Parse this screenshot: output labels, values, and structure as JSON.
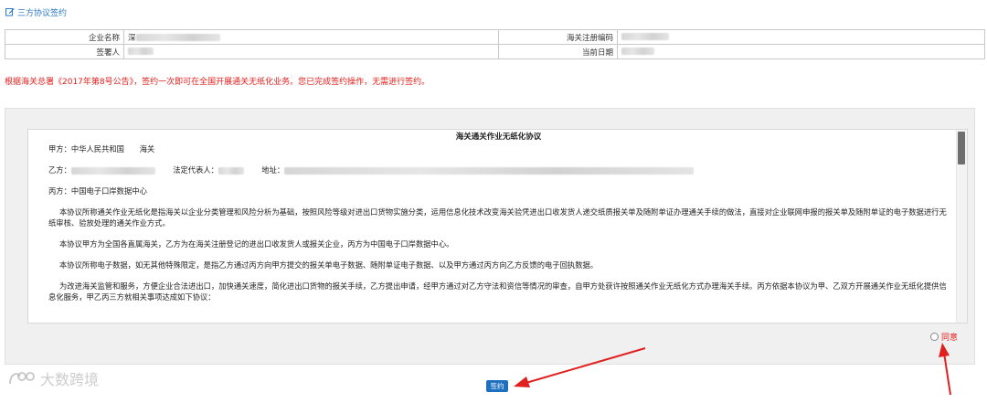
{
  "section": {
    "title": "三方协议签约"
  },
  "info": {
    "company_label": "企业名称",
    "company_value": "深",
    "customs_code_label": "海关注册编码",
    "signer_label": "签署人",
    "date_label": "当前日期"
  },
  "notice": "根据海关总署《2017年第8号公告》，签约一次即可在全国开展通关无纸化业务。您已完成签约操作，无需进行签约。",
  "agreement": {
    "title": "海关通关作业无纸化协议",
    "party_a": "甲方：中华人民共和国　　海关",
    "party_b_label": "乙方：",
    "legal_rep_label": "法定代表人：",
    "address_label": "地址：",
    "party_c": "丙方：中国电子口岸数据中心",
    "para1": "本协议所称通关作业无纸化是指海关以企业分类管理和风险分析为基础，按照风险等级对进出口货物实施分类，运用信息化技术改变海关验凭进出口收发货人递交纸质报关单及随附单证办理通关手续的做法，直接对企业联网申报的报关单及随附单证的电子数据进行无纸审核、验放处理的通关作业方式。",
    "para2": "本协议甲方为全国各直属海关，乙方为在海关注册登记的进出口收发货人或报关企业，丙方为中国电子口岸数据中心。",
    "para3": "本协议所称电子数据，如无其他特殊限定，是指乙方通过丙方向甲方提交的报关单电子数据、随附单证电子数据、以及甲方通过丙方向乙方反馈的电子回执数据。",
    "para4": "为改进海关监管和服务，方便企业合法进出口，加快通关速度，简化进出口货物的报关手续，乙方提出申请，经甲方通过对乙方守法和资信等情况的审查，自甲方处获许按照通关作业无纸化方式办理海关手续。丙方依据本协议为甲、乙双方开展通关作业无纸化提供信息化服务，甲乙丙三方就相关事项达成如下协议："
  },
  "agree": {
    "label": "同意"
  },
  "sign_button": {
    "label": "签约"
  },
  "watermark": {
    "text": "大数跨境"
  },
  "colors": {
    "accent": "#1d6fbf",
    "link": "#2b7ac4",
    "warning": "#e0201e",
    "panel": "#f0f0f0"
  },
  "icons": {
    "edit": "edit-icon",
    "watermark_logo": "logo-icon"
  }
}
